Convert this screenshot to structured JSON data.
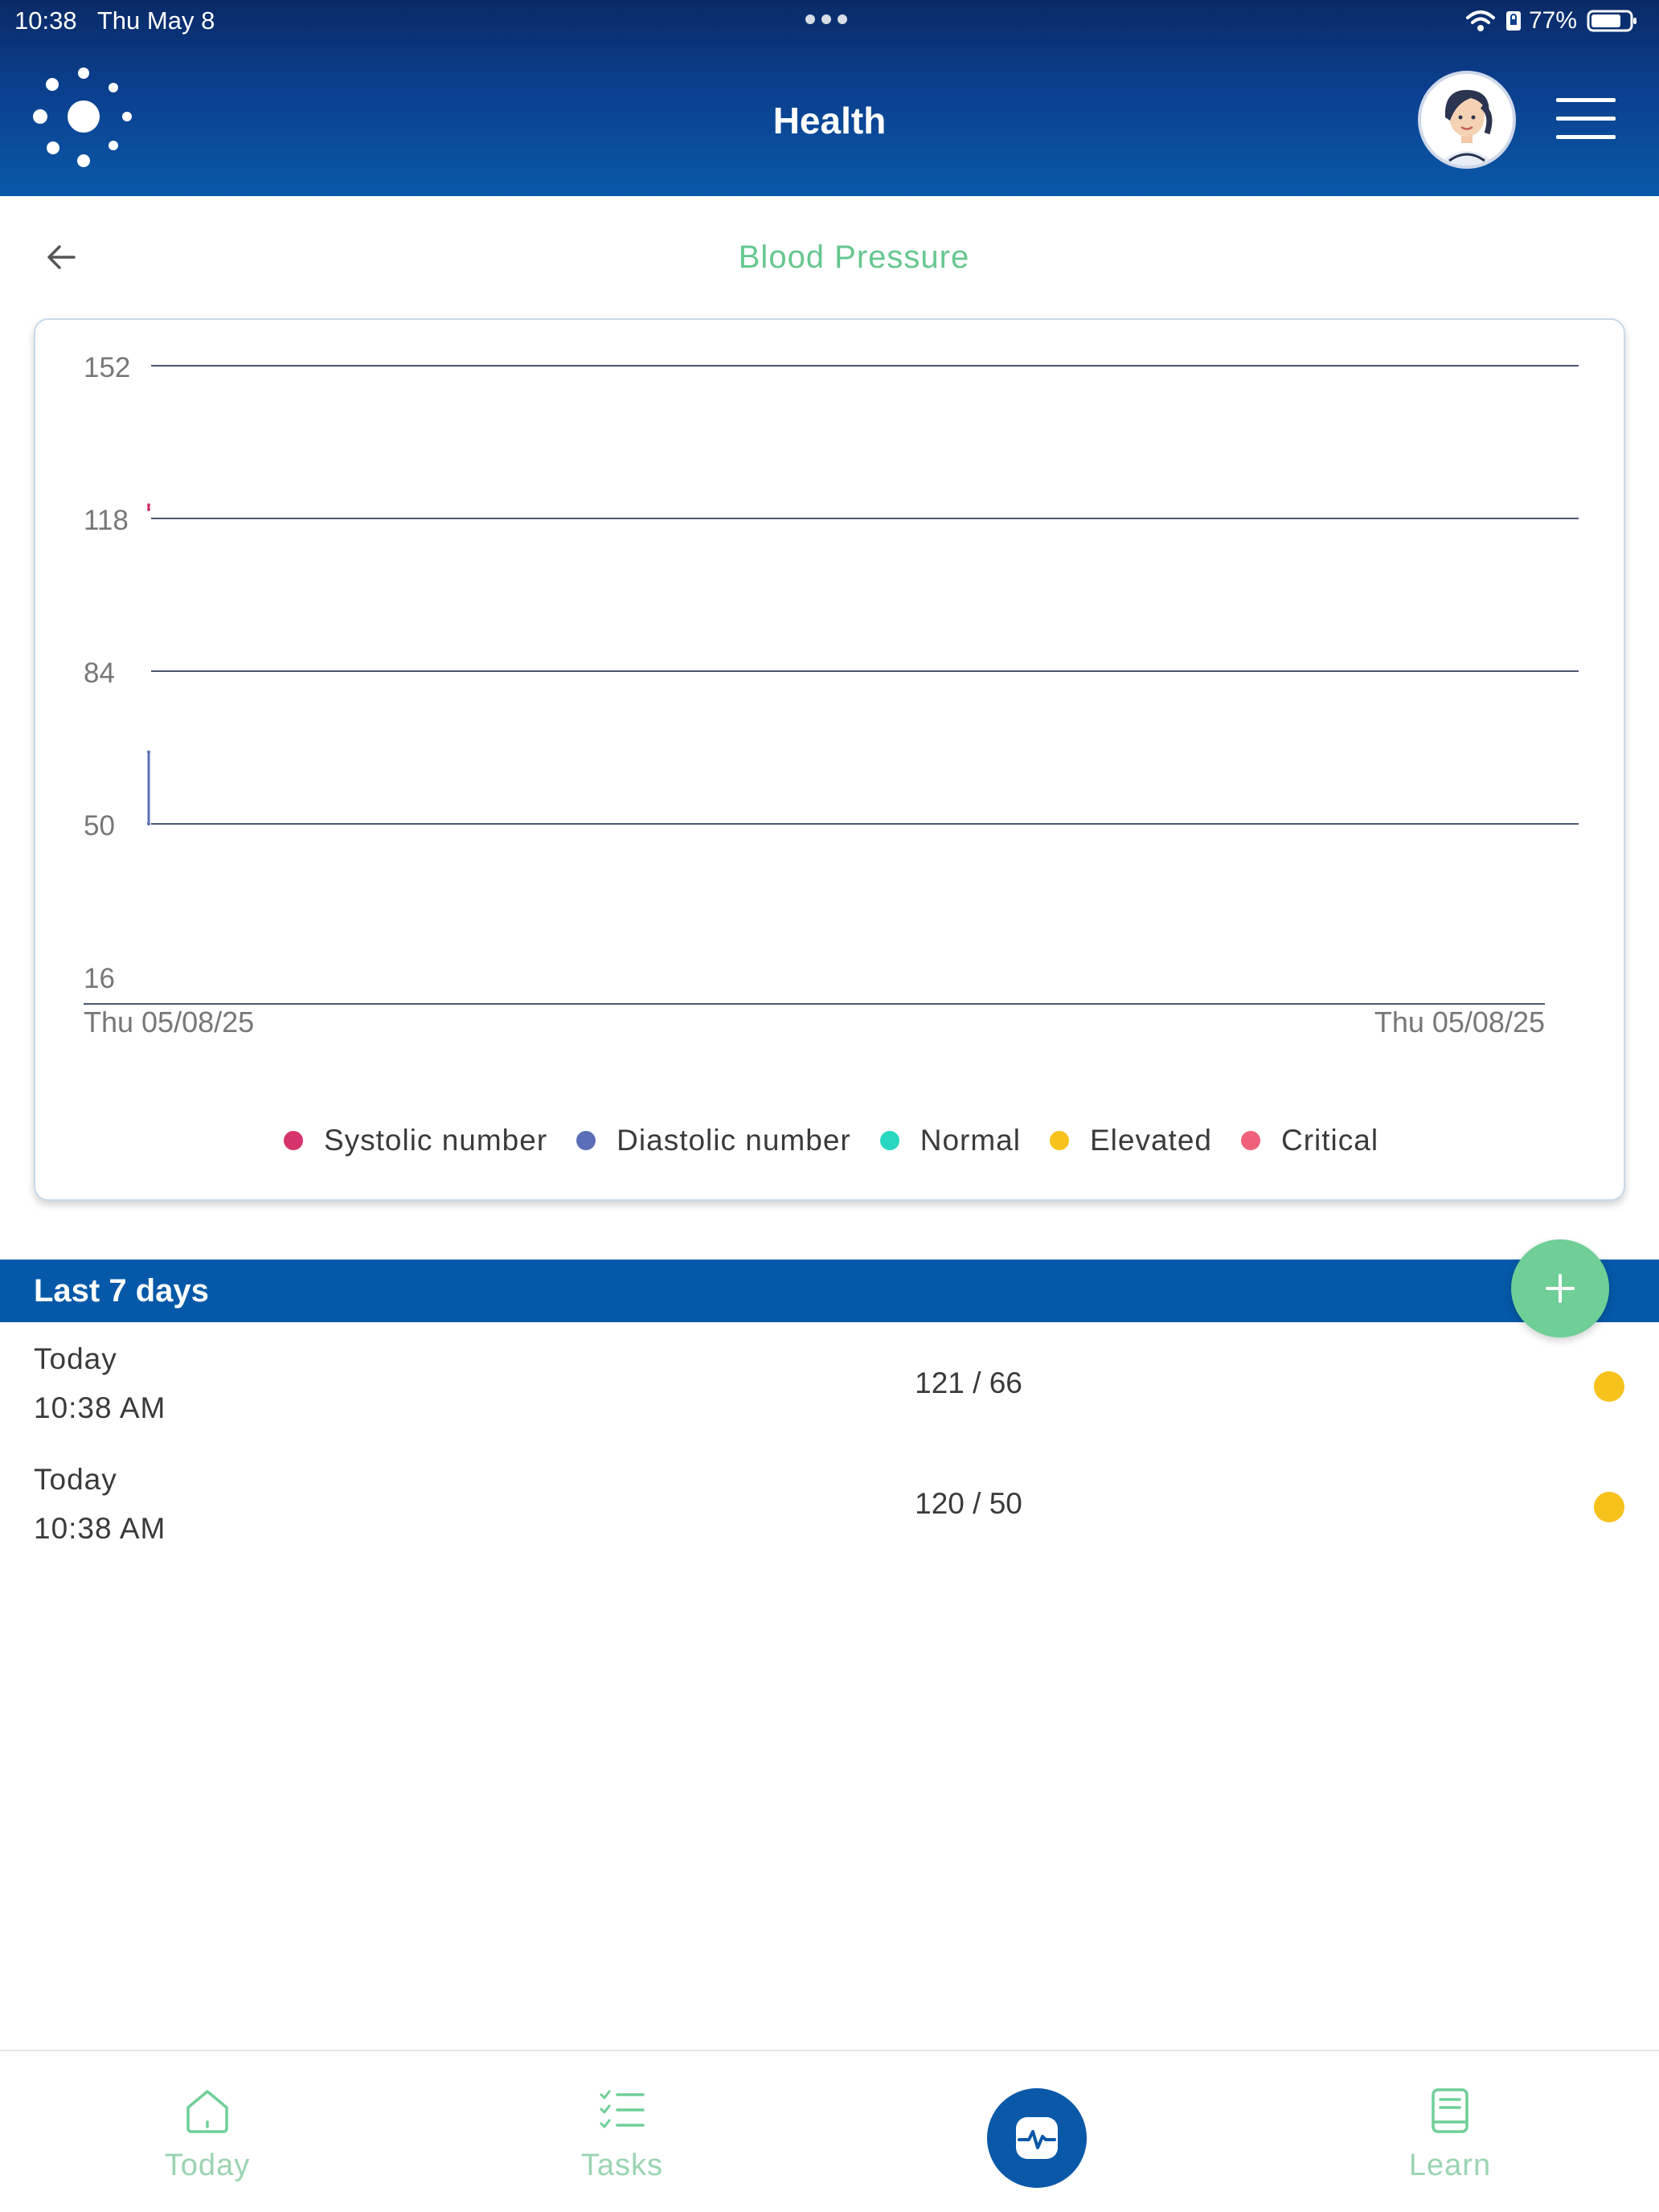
{
  "status_bar": {
    "time": "10:38",
    "date": "Thu May 8",
    "battery": "77%"
  },
  "header": {
    "title": "Health"
  },
  "page": {
    "title": "Blood Pressure"
  },
  "colors": {
    "header_dark": "#0a2a66",
    "brand_blue": "#0559a8",
    "accent_green": "#66c78f",
    "add_button": "#6fcf97",
    "systolic": "#d6336c",
    "diastolic": "#5b6fb8",
    "normal": "#27d7c0",
    "elevated": "#f7c21b",
    "critical": "#f0607a"
  },
  "chart_data": {
    "type": "line",
    "ylim": [
      16,
      152
    ],
    "y_ticks": [
      152,
      118,
      84,
      50,
      16
    ],
    "x_tick_labels": [
      "Thu 05/08/25",
      "Thu 05/08/25"
    ],
    "grid": true,
    "legend_position": "bottom",
    "series": [
      {
        "name": "Systolic number",
        "values": [
          121,
          120
        ]
      },
      {
        "name": "Diastolic number",
        "values": [
          66,
          50
        ]
      }
    ],
    "legend": [
      {
        "name": "Systolic number",
        "color": "#d6336c"
      },
      {
        "name": "Diastolic number",
        "color": "#5b6fb8"
      },
      {
        "name": "Normal",
        "color": "#27d7c0"
      },
      {
        "name": "Elevated",
        "color": "#f7c21b"
      },
      {
        "name": "Critical",
        "color": "#f0607a"
      }
    ]
  },
  "list": {
    "title": "Last 7 days",
    "readings": [
      {
        "date": "Today",
        "time": "10:38 AM",
        "value": "121 / 66",
        "status": "Elevated",
        "status_color": "#f7c21b"
      },
      {
        "date": "Today",
        "time": "10:38 AM",
        "value": "120 / 50",
        "status": "Elevated",
        "status_color": "#f7c21b"
      }
    ]
  },
  "nav": {
    "items": [
      {
        "label": "Today",
        "icon": "home-icon"
      },
      {
        "label": "Tasks",
        "icon": "tasks-icon"
      },
      {
        "label": "",
        "icon": "health-monitor-icon"
      },
      {
        "label": "Learn",
        "icon": "book-icon"
      }
    ]
  }
}
